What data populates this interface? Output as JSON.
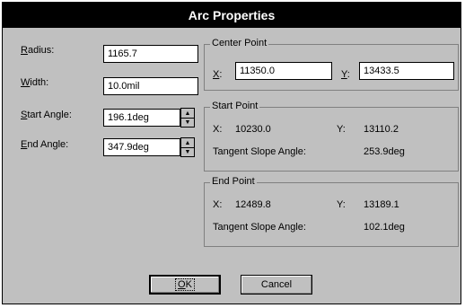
{
  "window": {
    "title": "Arc Properties"
  },
  "fields": {
    "radius": {
      "label_key": "R",
      "label_rest": "adius:",
      "value": "1165.7"
    },
    "width": {
      "label_key": "W",
      "label_rest": "idth:",
      "value": "10.0mil"
    },
    "start_angle": {
      "label_key": "S",
      "label_rest": "tart Angle:",
      "value": "196.1deg"
    },
    "end_angle": {
      "label_key": "E",
      "label_rest": "nd Angle:",
      "value": "347.9deg"
    }
  },
  "center_point": {
    "title": "Center Point",
    "x_key": "X",
    "x_rest": ":",
    "x_value": "11350.0",
    "y_key": "Y",
    "y_rest": ":",
    "y_value": "13433.5"
  },
  "start_point": {
    "title": "Start Point",
    "x_label": "X:",
    "x_value": "10230.0",
    "y_label": "Y:",
    "y_value": "13110.2",
    "slope_label": "Tangent Slope Angle:",
    "slope_value": "253.9deg"
  },
  "end_point": {
    "title": "End Point",
    "x_label": "X:",
    "x_value": "12489.8",
    "y_label": "Y:",
    "y_value": "13189.1",
    "slope_label": "Tangent Slope Angle:",
    "slope_value": "102.1deg"
  },
  "buttons": {
    "ok_key": "O",
    "ok_rest": "K",
    "cancel": "Cancel"
  },
  "icons": {
    "spin_up": "▲",
    "spin_down": "▼"
  }
}
